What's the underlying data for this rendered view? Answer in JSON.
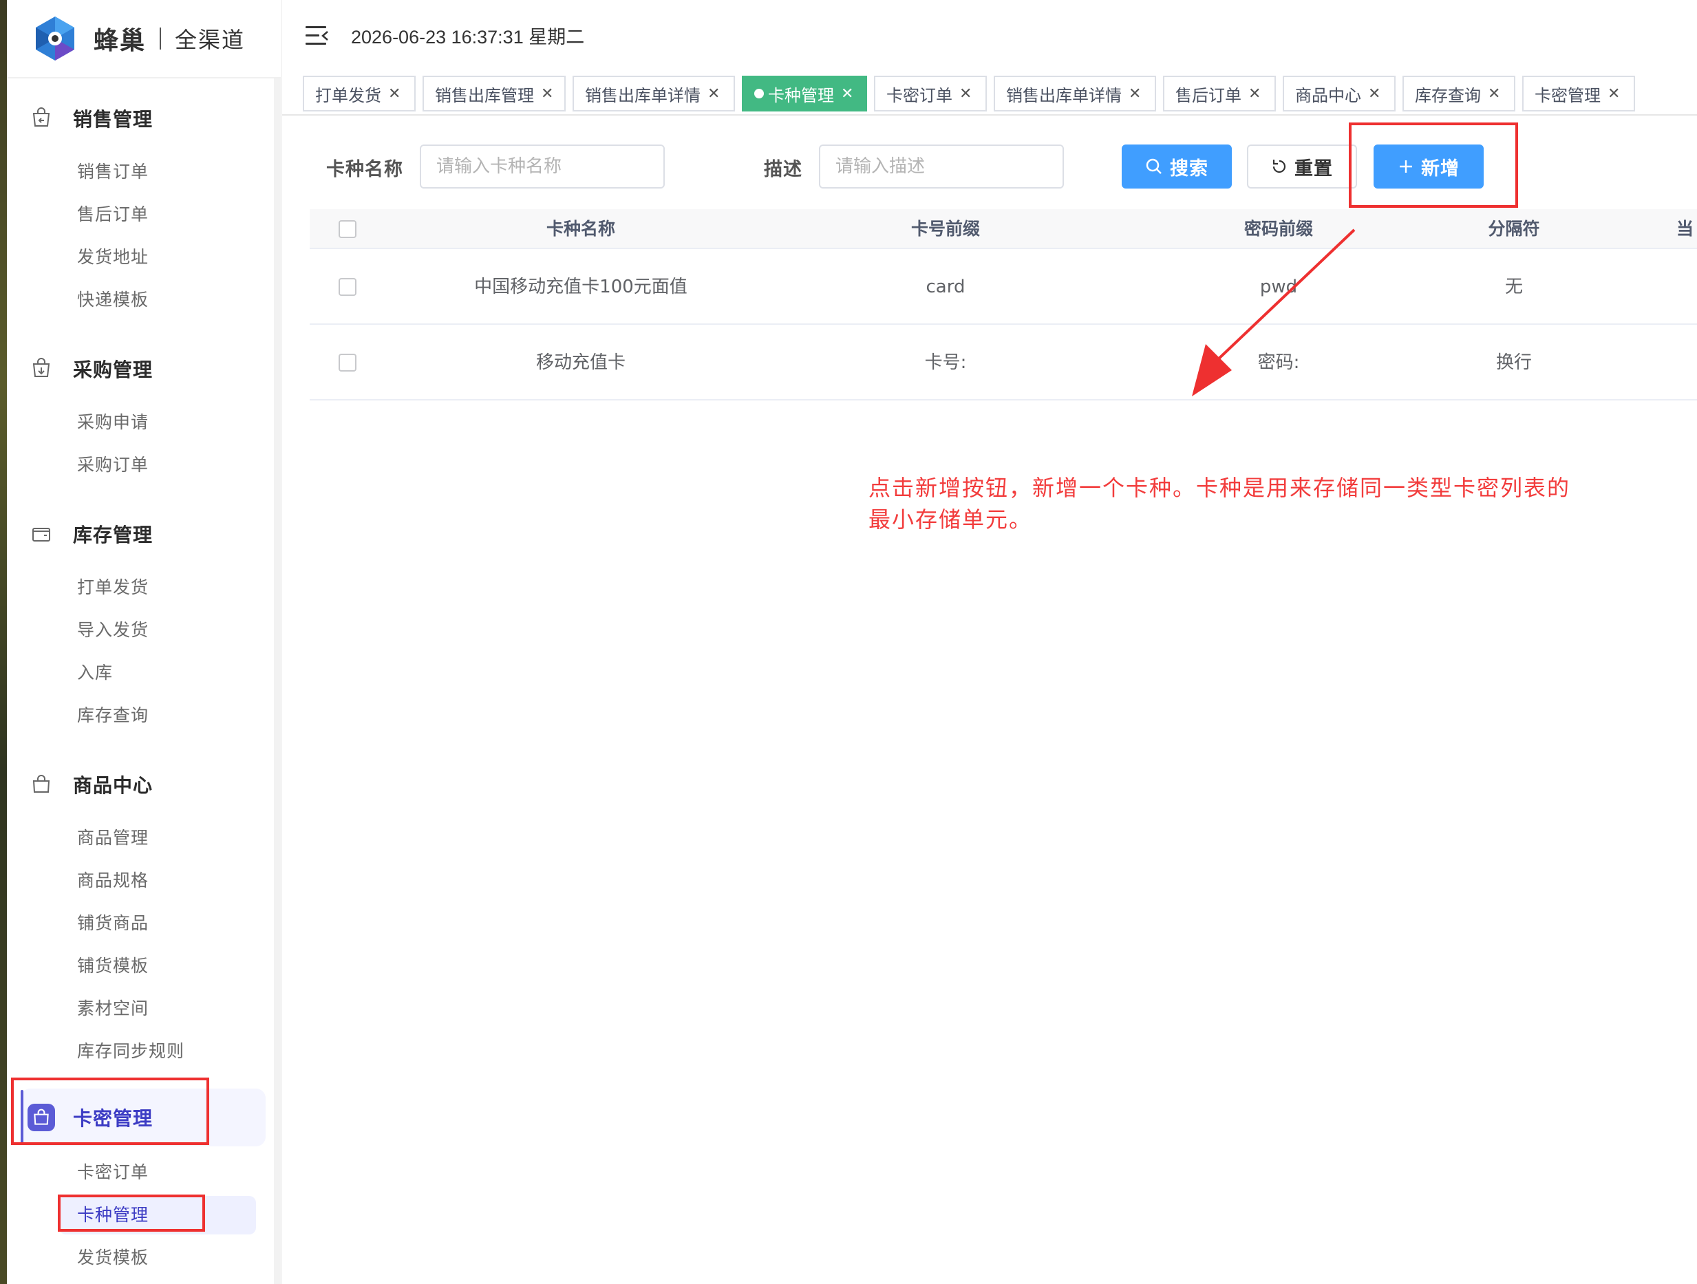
{
  "app": {
    "brand": "蜂巢",
    "subtitle": "全渠道",
    "datetime": "2026-06-23 16:37:31 星期二"
  },
  "sidebar": {
    "groups": [
      {
        "title": "销售管理",
        "icon": "cart-return-icon",
        "items": [
          "销售订单",
          "售后订单",
          "发货地址",
          "快递模板"
        ]
      },
      {
        "title": "采购管理",
        "icon": "purchase-bag-icon",
        "items": [
          "采购申请",
          "采购订单"
        ]
      },
      {
        "title": "库存管理",
        "icon": "wallet-icon",
        "items": [
          "打单发货",
          "导入发货",
          "入库",
          "库存查询"
        ]
      },
      {
        "title": "商品中心",
        "icon": "shopping-bag-icon",
        "items": [
          "商品管理",
          "商品规格",
          "铺货商品",
          "铺货模板",
          "素材空间",
          "库存同步规则"
        ]
      },
      {
        "title": "卡密管理",
        "icon": "card-bag-icon",
        "items": [
          "卡密订单",
          "卡种管理",
          "发货模板"
        ]
      }
    ]
  },
  "tabs": [
    {
      "label": "打单发货",
      "active": false
    },
    {
      "label": "销售出库管理",
      "active": false
    },
    {
      "label": "销售出库单详情",
      "active": false
    },
    {
      "label": "卡种管理",
      "active": true
    },
    {
      "label": "卡密订单",
      "active": false
    },
    {
      "label": "销售出库单详情",
      "active": false
    },
    {
      "label": "售后订单",
      "active": false
    },
    {
      "label": "商品中心",
      "active": false
    },
    {
      "label": "库存查询",
      "active": false
    },
    {
      "label": "卡密管理",
      "active": false
    }
  ],
  "search": {
    "name_label": "卡种名称",
    "name_placeholder": "请输入卡种名称",
    "desc_label": "描述",
    "desc_placeholder": "请输入描述",
    "search_button": "搜索",
    "reset_button": "重置",
    "add_button": "新增"
  },
  "table": {
    "columns": [
      "卡种名称",
      "卡号前缀",
      "密码前缀",
      "分隔符",
      "当"
    ],
    "rows": [
      [
        "中国移动充值卡100元面值",
        "card",
        "pwd",
        "无"
      ],
      [
        "移动充值卡",
        "卡号:",
        "密码:",
        "换行"
      ]
    ]
  },
  "annotation": {
    "line1": "点击新增按钮，新增一个卡种。卡种是用来存储同一类型卡密列表的",
    "line2": "最小存储单元。",
    "color": "#f23c3c"
  },
  "colors": {
    "primary": "#409eff",
    "active_tab": "#42b983",
    "menu_active": "#5b5bd6",
    "annotation_red": "#ee3030"
  }
}
